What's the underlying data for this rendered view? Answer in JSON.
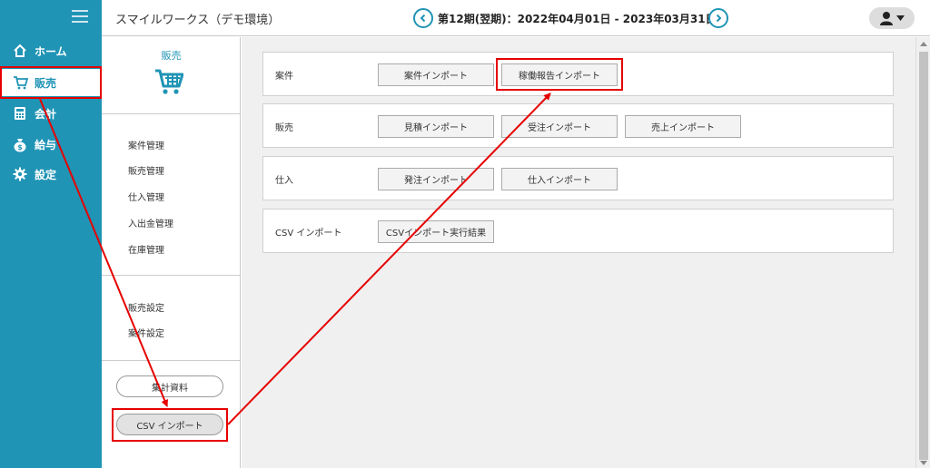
{
  "app": {
    "title": "スマイルワークス（デモ環境）"
  },
  "header": {
    "period": "第12期(翌期)：2022年04月01日 - 2023年03月31日"
  },
  "nav": {
    "items": [
      {
        "label": "ホーム"
      },
      {
        "label": "販売"
      },
      {
        "label": "会計"
      },
      {
        "label": "給与"
      },
      {
        "label": "設定"
      }
    ]
  },
  "sidebar": {
    "title": "販売",
    "links": [
      "案件管理",
      "販売管理",
      "仕入管理",
      "入出金管理",
      "在庫管理"
    ],
    "settings": [
      "販売設定",
      "案件設定"
    ],
    "buttons": {
      "report": "集計資料",
      "csv_import": "CSV インポート"
    }
  },
  "sections": [
    {
      "label": "案件",
      "buttons": [
        "案件インポート",
        "稼働報告インポート"
      ]
    },
    {
      "label": "販売",
      "buttons": [
        "見積インポート",
        "受注インポート",
        "売上インポート"
      ]
    },
    {
      "label": "仕入",
      "buttons": [
        "発注インポート",
        "仕入インポート"
      ]
    },
    {
      "label": "CSV インポート",
      "buttons": [
        "CSVインポート実行結果"
      ]
    }
  ],
  "colors": {
    "primary": "#2094b5",
    "annotation": "#e60000"
  }
}
